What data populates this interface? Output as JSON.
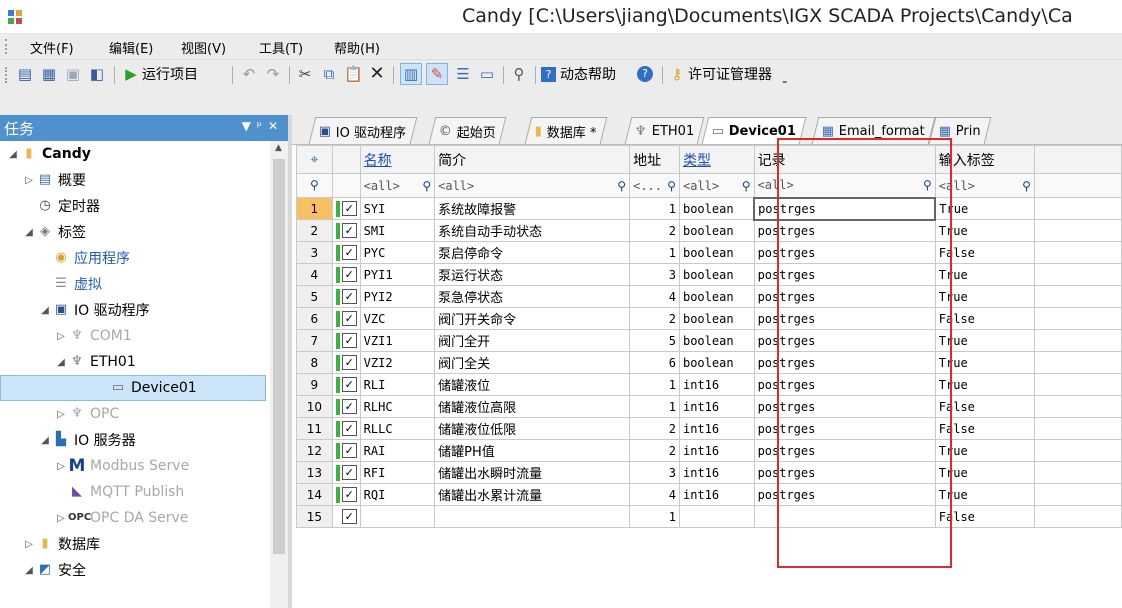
{
  "window": {
    "title": "Candy [C:\\Users\\jiang\\Documents\\IGX SCADA Projects\\Candy\\Ca"
  },
  "menu": [
    "文件(F)",
    "编辑(E)",
    "视图(V)",
    "工具(T)",
    "帮助(H)"
  ],
  "toolbar": {
    "run_label": "运行项目",
    "help_label": "动态帮助",
    "license_label": "许可证管理器"
  },
  "left_pane": {
    "title": "任务",
    "tree": [
      {
        "label": "Candy",
        "icon": "project-icon"
      },
      {
        "label": "概要",
        "icon": "summary-icon"
      },
      {
        "label": "定时器",
        "icon": "clock-icon"
      },
      {
        "label": "标签",
        "icon": "tag-icon"
      },
      {
        "label": "应用程序",
        "icon": "app-tag-icon"
      },
      {
        "label": "虚拟",
        "icon": "virtual-icon"
      },
      {
        "label": "IO 驱动程序",
        "icon": "driver-icon"
      },
      {
        "label": "COM1",
        "icon": "port-icon"
      },
      {
        "label": "ETH01",
        "icon": "port-icon"
      },
      {
        "label": "Device01",
        "icon": "device-icon"
      },
      {
        "label": "OPC",
        "icon": "port-icon"
      },
      {
        "label": "IO 服务器",
        "icon": "server-icon"
      },
      {
        "label": "Modbus Serve",
        "icon": "modbus-icon"
      },
      {
        "label": "MQTT Publish",
        "icon": "mqtt-icon"
      },
      {
        "label": "OPC DA Serve",
        "icon": "opc-icon"
      },
      {
        "label": "数据库",
        "icon": "database-icon"
      },
      {
        "label": "安全",
        "icon": "security-icon"
      }
    ]
  },
  "tabs": [
    {
      "label": "IO 驱动程序",
      "icon": "driver-icon"
    },
    {
      "label": "起始页",
      "icon": "home-icon"
    },
    {
      "label": "数据库 *",
      "icon": "database-icon"
    },
    {
      "label": "ETH01",
      "icon": "port-icon"
    },
    {
      "label": "Device01",
      "icon": "device-icon"
    },
    {
      "label": "Email_format",
      "icon": "table-icon"
    },
    {
      "label": "Prin",
      "icon": "table-icon"
    }
  ],
  "grid": {
    "headers": [
      "名称",
      "简介",
      "地址",
      "类型",
      "记录",
      "输入标签"
    ],
    "filters": [
      "<all>",
      "<all>",
      "<...",
      "<all>",
      "<all>",
      "<all>"
    ],
    "rows": [
      {
        "n": "1",
        "name": "SYI",
        "desc": "系统故障报警",
        "addr": "1",
        "type": "boolean",
        "log": "postrges",
        "input": "True"
      },
      {
        "n": "2",
        "name": "SMI",
        "desc": "系统自动手动状态",
        "addr": "2",
        "type": "boolean",
        "log": "postrges",
        "input": "True"
      },
      {
        "n": "3",
        "name": "PYC",
        "desc": "泵启停命令",
        "addr": "1",
        "type": "boolean",
        "log": "postrges",
        "input": "False"
      },
      {
        "n": "4",
        "name": "PYI1",
        "desc": "泵运行状态",
        "addr": "3",
        "type": "boolean",
        "log": "postrges",
        "input": "True"
      },
      {
        "n": "5",
        "name": "PYI2",
        "desc": "泵急停状态",
        "addr": "4",
        "type": "boolean",
        "log": "postrges",
        "input": "True"
      },
      {
        "n": "6",
        "name": "VZC",
        "desc": "阀门开关命令",
        "addr": "2",
        "type": "boolean",
        "log": "postrges",
        "input": "False"
      },
      {
        "n": "7",
        "name": "VZI1",
        "desc": "阀门全开",
        "addr": "5",
        "type": "boolean",
        "log": "postrges",
        "input": "True"
      },
      {
        "n": "8",
        "name": "VZI2",
        "desc": "阀门全关",
        "addr": "6",
        "type": "boolean",
        "log": "postrges",
        "input": "True"
      },
      {
        "n": "9",
        "name": "RLI",
        "desc": "储罐液位",
        "addr": "1",
        "type": "int16",
        "log": "postrges",
        "input": "True"
      },
      {
        "n": "10",
        "name": "RLHC",
        "desc": "储罐液位高限",
        "addr": "1",
        "type": "int16",
        "log": "postrges",
        "input": "False"
      },
      {
        "n": "11",
        "name": "RLLC",
        "desc": "储罐液位低限",
        "addr": "2",
        "type": "int16",
        "log": "postrges",
        "input": "False"
      },
      {
        "n": "12",
        "name": "RAI",
        "desc": "储罐PH值",
        "addr": "2",
        "type": "int16",
        "log": "postrges",
        "input": "True"
      },
      {
        "n": "13",
        "name": "RFI",
        "desc": "储罐出水瞬时流量",
        "addr": "3",
        "type": "int16",
        "log": "postrges",
        "input": "True"
      },
      {
        "n": "14",
        "name": "RQI",
        "desc": "储罐出水累计流量",
        "addr": "4",
        "type": "int16",
        "log": "postrges",
        "input": "True"
      },
      {
        "n": "15",
        "name": "",
        "desc": "",
        "addr": "1",
        "type": "",
        "log": "",
        "input": "False"
      }
    ]
  },
  "colors": {
    "pane_header": "#4f91cf",
    "selected_column": "#f6c163",
    "annotation_box": "#e02a2a",
    "enabled_mark": "#3db33d"
  }
}
